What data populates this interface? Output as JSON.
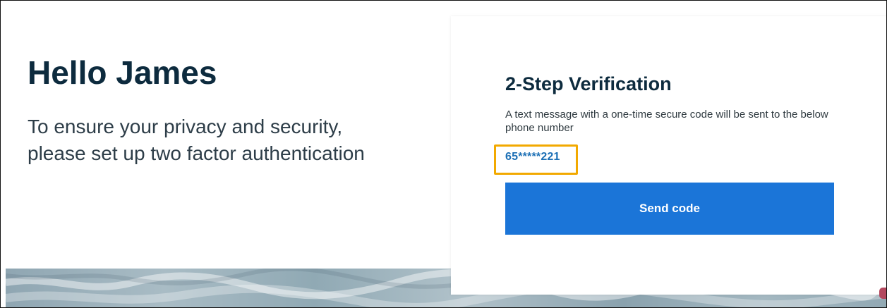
{
  "left": {
    "greeting": "Hello James",
    "intro": "To ensure your privacy and security, please set up two factor authentication"
  },
  "card": {
    "title": "2-Step Verification",
    "description": "A text message with a one-time secure code will be sent to the below phone number",
    "phone_number": "65*****221",
    "send_button_label": "Send code"
  },
  "colors": {
    "heading": "#0d2b3e",
    "link": "#1b6fb5",
    "primary_button": "#1b75d8",
    "highlight": "#f2a900",
    "page_background": "#ffffff"
  }
}
